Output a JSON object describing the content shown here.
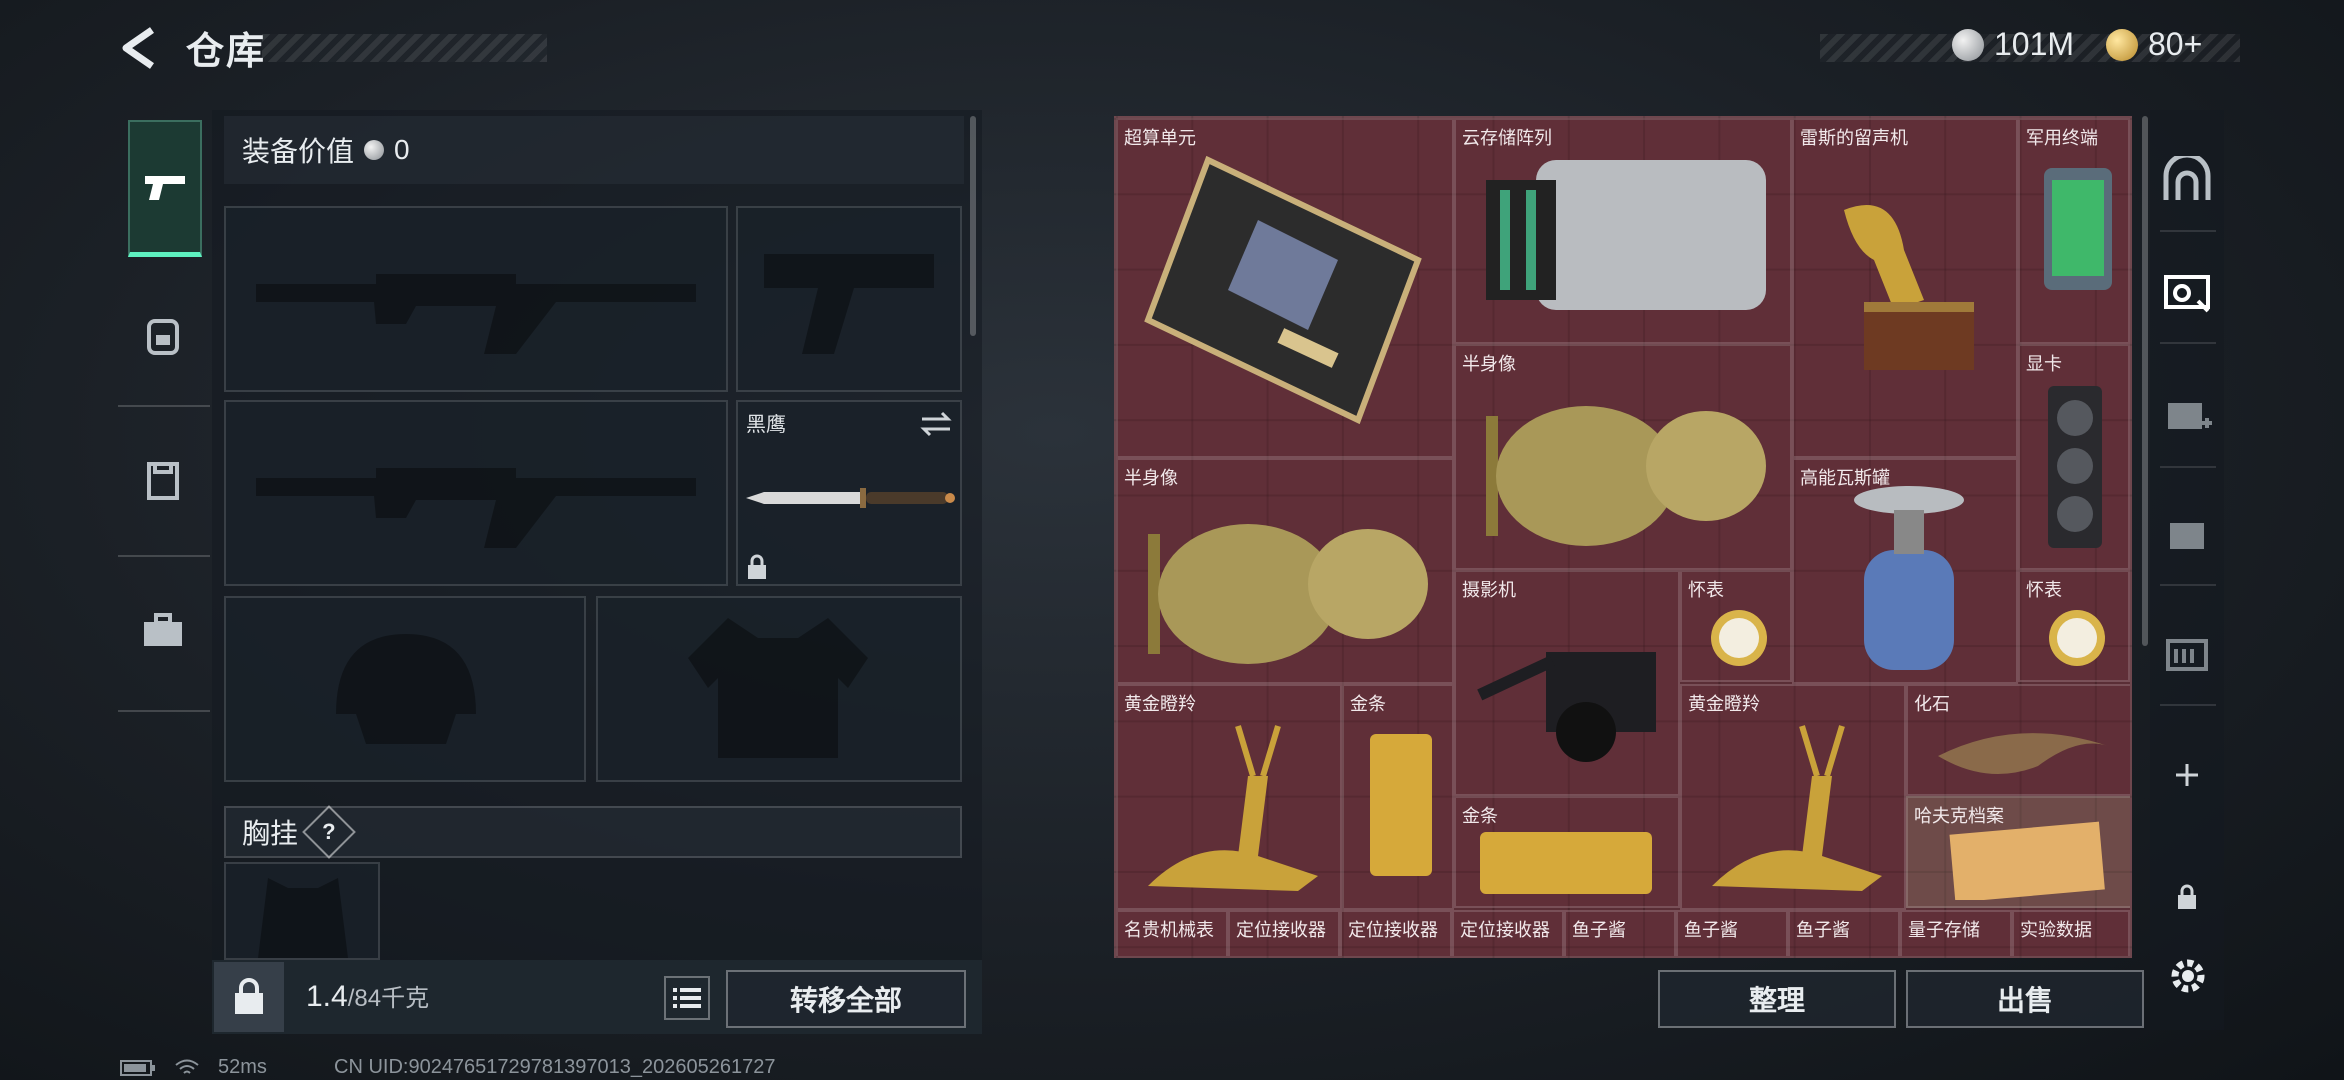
{
  "header": {
    "title": "仓库"
  },
  "currency": {
    "coins": "101M",
    "tokens": "80+"
  },
  "left": {
    "equip_value_label": "装备价值",
    "equip_value": "0",
    "melee_label": "黑鹰",
    "chest_label": "胸挂",
    "chest_help": "?",
    "weight_current": "1.4",
    "weight_max": "/84千克",
    "transfer_all": "转移全部"
  },
  "stash": {
    "items": [
      "超算单元",
      "云存储阵列",
      "雷斯的留声机",
      "军用终端",
      "半身像",
      "显卡",
      "半身像",
      "高能瓦斯罐",
      "摄影机",
      "怀表",
      "怀表",
      "黄金瞪羚",
      "金条",
      "黄金瞪羚",
      "化石",
      "金条",
      "哈夫克档案",
      "名贵机械表",
      "定位接收器",
      "定位接收器",
      "定位接收器",
      "鱼子酱",
      "鱼子酱",
      "鱼子酱",
      "量子存储",
      "实验数据"
    ]
  },
  "actions": {
    "sort": "整理",
    "sell": "出售"
  },
  "status": {
    "ping": "52ms",
    "uid": "CN UID:90247651729781397013_202605261727"
  },
  "colors": {
    "stash_bg": "#5a2e36",
    "tab_active": "#5ef1c0"
  }
}
